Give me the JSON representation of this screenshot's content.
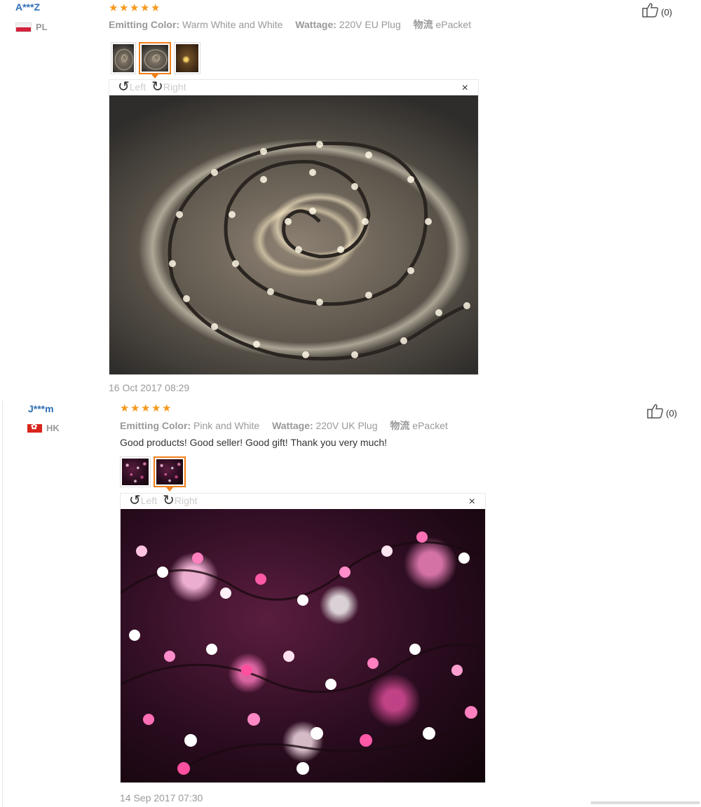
{
  "reviews": [
    {
      "user": "A***Z",
      "country": "PL",
      "rating": 5,
      "attributes": [
        {
          "key": "Emitting Color:",
          "value": "Warm White and White"
        },
        {
          "key": "Wattage:",
          "value": "220V EU Plug"
        },
        {
          "key": "物流",
          "value": "ePacket"
        }
      ],
      "useful": "(0)",
      "viewer": {
        "rotate_left": "Left",
        "rotate_right": "Right",
        "close": "×"
      },
      "date": "16 Oct 2017 08:29",
      "thumbnail_count": 3,
      "active_thumbnail": 2
    },
    {
      "user": "J***m",
      "country": "HK",
      "rating": 5,
      "attributes": [
        {
          "key": "Emitting Color:",
          "value": "Pink and White"
        },
        {
          "key": "Wattage:",
          "value": "220V UK Plug"
        },
        {
          "key": "物流",
          "value": "ePacket"
        }
      ],
      "feedback": "Good products! Good seller! Good gift! Thank you very much!",
      "useful": "(0)",
      "viewer": {
        "rotate_left": "Left",
        "rotate_right": "Right",
        "close": "×"
      },
      "date": "14 Sep 2017 07:30",
      "thumbnail_count": 2,
      "active_thumbnail": 2
    }
  ],
  "icons": {
    "star": "★",
    "thumbs_up": "thumbs-up-icon",
    "rotate_left": "↺",
    "rotate_right": "↻"
  },
  "colors": {
    "username": "#2e6fb5",
    "star": "#f7981c",
    "active_thumbnail_border": "#f07f1a",
    "muted_text": "#999999"
  }
}
